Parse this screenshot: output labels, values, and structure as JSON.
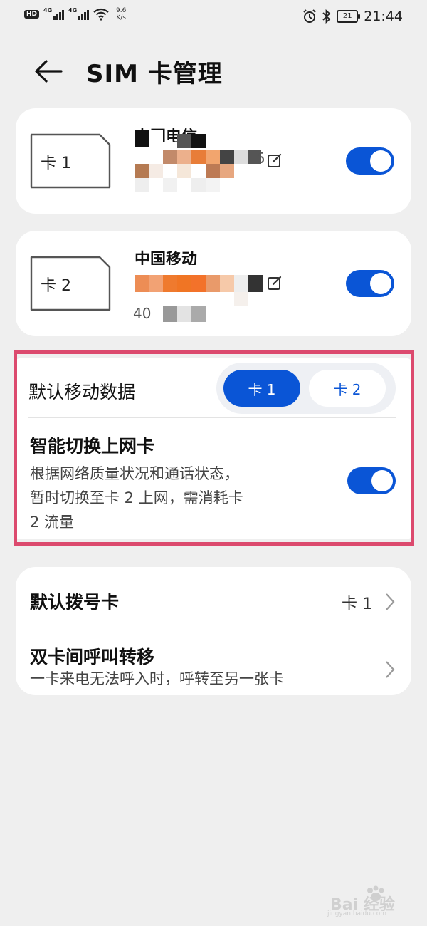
{
  "status_bar": {
    "hd": "HD",
    "net1": "4G",
    "net2": "4G",
    "speed_value": "9.6",
    "speed_unit": "K/s",
    "battery": "21",
    "time": "21:44"
  },
  "header": {
    "title": "SIM 卡管理"
  },
  "sim_cards": [
    {
      "label": "卡 1",
      "carrier": "中国电信",
      "number_tail": "5",
      "enabled": true
    },
    {
      "label": "卡 2",
      "carrier": "中国移动",
      "number_prefix": "40",
      "enabled": true
    }
  ],
  "default_data": {
    "title": "默认移动数据",
    "options": [
      "卡 1",
      "卡 2"
    ],
    "selected": "卡 1"
  },
  "smart_switch": {
    "title": "智能切换上网卡",
    "desc_line1": "根据网络质量状况和通话状态，",
    "desc_line2": "暂时切换至卡 2 上网，需消耗卡",
    "desc_line3": "2 流量",
    "enabled": true
  },
  "default_call": {
    "title": "默认拨号卡",
    "value": "卡 1"
  },
  "call_forward": {
    "title": "双卡间呼叫转移",
    "desc": "一卡来电无法呼入时，呼转至另一张卡"
  },
  "watermark": {
    "text": "Bai 经验",
    "sub": "jingyan.baidu.com"
  },
  "colors": {
    "accent": "#0a55d6",
    "highlight": "#dc4a6e",
    "background": "#efefef"
  }
}
